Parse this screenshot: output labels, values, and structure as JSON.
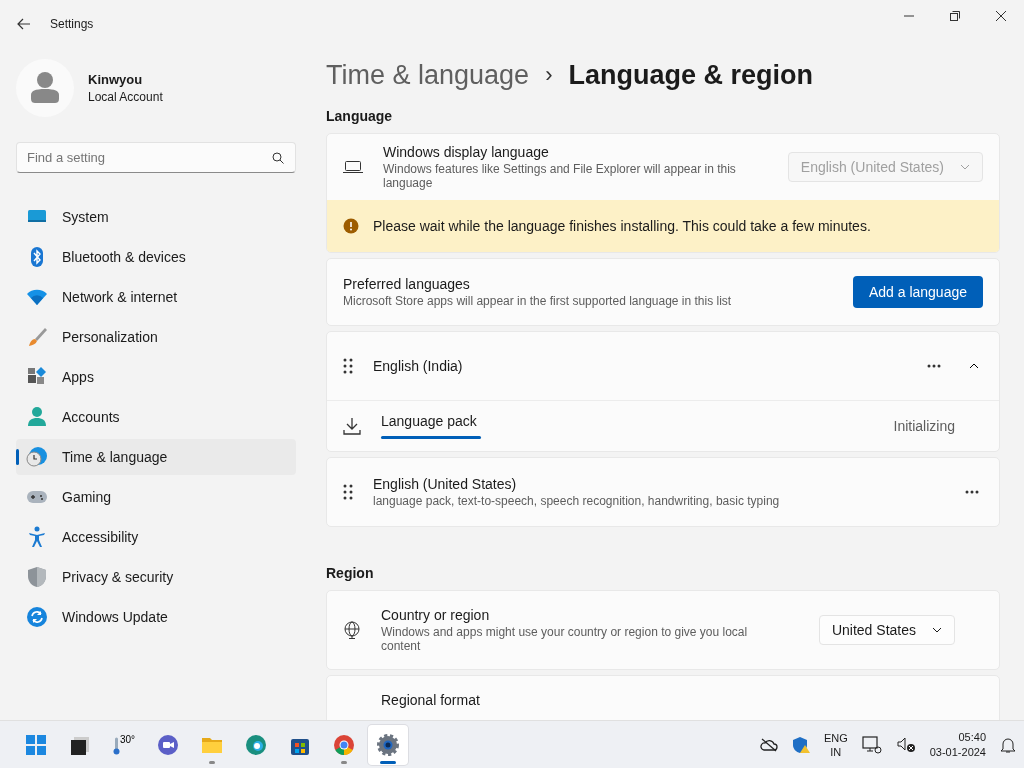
{
  "window": {
    "title": "Settings"
  },
  "profile": {
    "name": "Kinwyou",
    "account": "Local Account"
  },
  "search": {
    "placeholder": "Find a setting"
  },
  "sidebar": {
    "items": [
      {
        "label": "System",
        "selected": false
      },
      {
        "label": "Bluetooth & devices",
        "selected": false
      },
      {
        "label": "Network & internet",
        "selected": false
      },
      {
        "label": "Personalization",
        "selected": false
      },
      {
        "label": "Apps",
        "selected": false
      },
      {
        "label": "Accounts",
        "selected": false
      },
      {
        "label": "Time & language",
        "selected": true
      },
      {
        "label": "Gaming",
        "selected": false
      },
      {
        "label": "Accessibility",
        "selected": false
      },
      {
        "label": "Privacy & security",
        "selected": false
      },
      {
        "label": "Windows Update",
        "selected": false
      }
    ]
  },
  "breadcrumb": {
    "parent": "Time & language",
    "separator": "›",
    "current": "Language & region"
  },
  "language": {
    "heading": "Language",
    "display_language": {
      "title": "Windows display language",
      "description": "Windows features like Settings and File Explorer will appear in this language",
      "value": "English (United States)",
      "disabled": true
    },
    "warning": "Please wait while the language finishes installing. This could take a few minutes.",
    "preferred": {
      "title": "Preferred languages",
      "description": "Microsoft Store apps will appear in the first supported language in this list",
      "button": "Add a language"
    },
    "languages": [
      {
        "name": "English (India)",
        "expanded": true,
        "pack": {
          "label": "Language pack",
          "status": "Initializing",
          "level": 1
        }
      },
      {
        "name": "English (United States)",
        "description": "language pack, text-to-speech, speech recognition, handwriting, basic typing"
      }
    ]
  },
  "region": {
    "heading": "Region",
    "country": {
      "title": "Country or region",
      "description": "Windows and apps might use your country or region to give you local content",
      "value": "United States"
    },
    "format": {
      "title": "Regional format"
    }
  },
  "taskbar": {
    "weather": "30°",
    "apps": [
      {
        "kind": "start",
        "running": false,
        "selected": false
      },
      {
        "kind": "desktop",
        "running": false,
        "selected": false
      },
      {
        "kind": "weather",
        "running": false,
        "selected": false
      },
      {
        "kind": "chat",
        "running": false,
        "selected": false
      },
      {
        "kind": "explorer",
        "running": true,
        "selected": false
      },
      {
        "kind": "edge",
        "running": false,
        "selected": false
      },
      {
        "kind": "store",
        "running": false,
        "selected": false
      },
      {
        "kind": "chrome",
        "running": true,
        "selected": false
      },
      {
        "kind": "settings",
        "running": true,
        "selected": true
      }
    ],
    "language": [
      "ENG",
      "IN"
    ],
    "time": "05:40",
    "date": "03-01-2024"
  }
}
